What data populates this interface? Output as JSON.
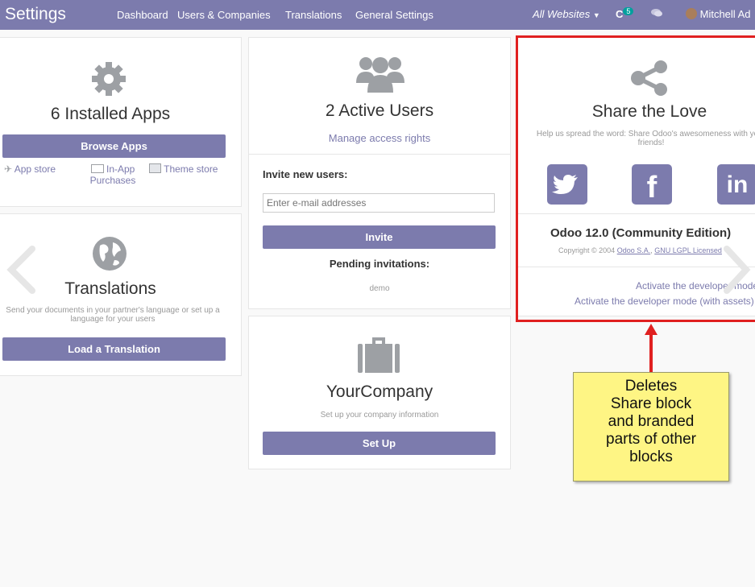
{
  "topbar": {
    "brand": "Settings",
    "menu": [
      "Dashboard",
      "Users & Companies",
      "Translations",
      "General Settings"
    ],
    "website_select": "All Websites",
    "activity_count": "5",
    "user_name": "Mitchell Ad"
  },
  "apps": {
    "title": "6 Installed Apps",
    "button": "Browse Apps",
    "links": [
      "App store",
      "In-App Purchases",
      "Theme store"
    ],
    "icon": "gear-icon"
  },
  "translations": {
    "title": "Translations",
    "description": "Send your documents in your partner's language or set up a language for your users",
    "button": "Load a Translation",
    "icon": "globe-icon"
  },
  "users": {
    "title": "2 Active Users",
    "manage_link": "Manage access rights",
    "invite_label": "Invite new users:",
    "email_placeholder": "Enter e-mail addresses",
    "invite_button": "Invite",
    "pending_label": "Pending invitations:",
    "pending_user": "demo",
    "icon": "users-icon"
  },
  "company": {
    "title": "YourCompany",
    "description": "Set up your company information",
    "button": "Set Up",
    "icon": "briefcase-icon"
  },
  "share": {
    "title": "Share the Love",
    "description": "Help us spread the word: Share Odoo's awesomeness with your friends!",
    "edition": "Odoo 12.0 (Community Edition)",
    "copyright": "Copyright © 2004",
    "copyright_link1": "Odoo S.A.",
    "copyright_link2": "GNU LGPL Licensed",
    "developer_mode": "Activate the developer mode",
    "developer_mode_assets": "Activate the developer mode (with assets)",
    "icon": "share-icon"
  },
  "annotation": {
    "text": "Deletes Share block and branded parts of other blocks",
    "lines": [
      "Deletes",
      "Share block",
      "and branded",
      "parts of other",
      "blocks"
    ],
    "highlight_color": "#e02020",
    "callout_color": "#fef584"
  },
  "colors": {
    "primary": "#7c7bad",
    "badge": "#00a09d"
  }
}
